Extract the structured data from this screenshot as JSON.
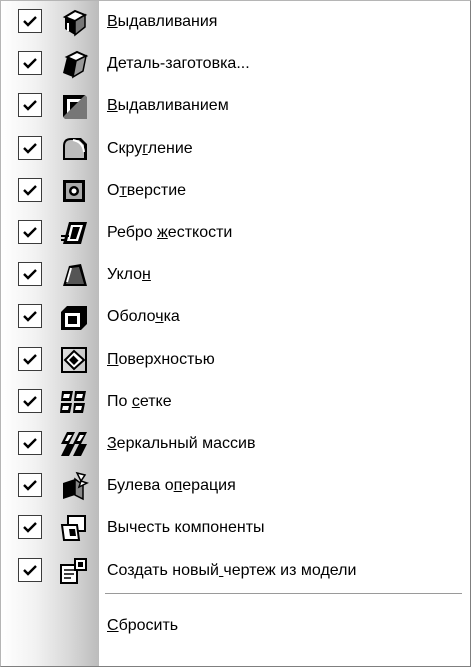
{
  "menu": {
    "items": [
      {
        "label": "Выдавливания",
        "mnemonic": 0,
        "checked": true,
        "icon": "extrusion-icon"
      },
      {
        "label": "Деталь-заготовка...",
        "mnemonic": 0,
        "checked": true,
        "icon": "part-blank-icon"
      },
      {
        "label": "Выдавливанием",
        "mnemonic": 0,
        "checked": true,
        "icon": "cut-extrusion-icon"
      },
      {
        "label": "Скругление",
        "mnemonic": 4,
        "checked": true,
        "icon": "fillet-icon"
      },
      {
        "label": "Отверстие",
        "mnemonic": 1,
        "checked": true,
        "icon": "hole-icon"
      },
      {
        "label": "Ребро жесткости",
        "mnemonic": 6,
        "checked": true,
        "icon": "rib-icon"
      },
      {
        "label": "Уклон",
        "mnemonic": 4,
        "checked": true,
        "icon": "draft-icon"
      },
      {
        "label": "Оболочка",
        "mnemonic": 5,
        "checked": true,
        "icon": "shell-icon"
      },
      {
        "label": "Поверхностью",
        "mnemonic": 0,
        "checked": true,
        "icon": "surface-cut-icon"
      },
      {
        "label": "По сетке",
        "mnemonic": 3,
        "checked": true,
        "icon": "grid-array-icon"
      },
      {
        "label": "Зеркальный массив",
        "mnemonic": 0,
        "checked": true,
        "icon": "mirror-array-icon"
      },
      {
        "label": "Булева операция",
        "mnemonic": 8,
        "checked": true,
        "icon": "boolean-operation-icon"
      },
      {
        "label": "Вычесть компоненты",
        "mnemonic": -1,
        "checked": true,
        "icon": "subtract-components-icon"
      },
      {
        "label": "Создать новый чертеж из модели",
        "mnemonic": 13,
        "checked": true,
        "icon": "new-drawing-from-model-icon"
      }
    ],
    "reset": {
      "label": "Сбросить",
      "mnemonic": 0
    }
  }
}
